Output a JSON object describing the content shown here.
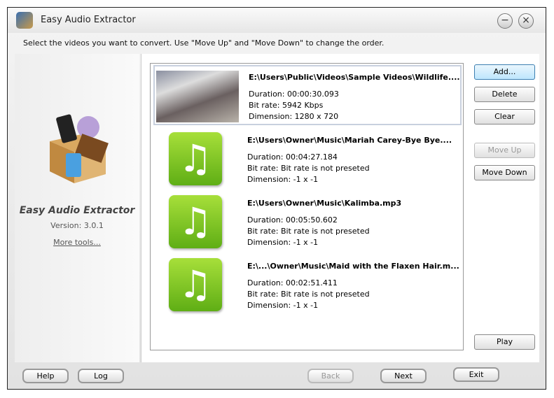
{
  "window": {
    "title": "Easy Audio Extractor",
    "minimize": "−",
    "close": "×"
  },
  "instruction": "Select the videos you want to convert. Use \"Move Up\" and \"Move Down\" to change the order.",
  "sidebar": {
    "app_name": "Easy Audio Extractor",
    "version": "Version: 3.0.1",
    "more_tools": "More tools..."
  },
  "files": [
    {
      "path": "E:\\Users\\Public\\Videos\\Sample Videos\\Wildlife....",
      "duration": "Duration: 00:00:30.093",
      "bitrate": "Bit rate: 5942 Kbps",
      "dimension": "Dimension: 1280 x 720",
      "type": "video"
    },
    {
      "path": "E:\\Users\\Owner\\Music\\Mariah Carey-Bye Bye....",
      "duration": "Duration: 00:04:27.184",
      "bitrate": "Bit rate: Bit rate is not preseted",
      "dimension": "Dimension: -1 x -1",
      "type": "audio"
    },
    {
      "path": "E:\\Users\\Owner\\Music\\Kalimba.mp3",
      "duration": "Duration: 00:05:50.602",
      "bitrate": "Bit rate: Bit rate is not preseted",
      "dimension": "Dimension: -1 x -1",
      "type": "audio"
    },
    {
      "path": "E:\\...\\Owner\\Music\\Maid with the Flaxen Hair.m...",
      "duration": "Duration: 00:02:51.411",
      "bitrate": "Bit rate: Bit rate is not preseted",
      "dimension": "Dimension: -1 x -1",
      "type": "audio"
    }
  ],
  "buttons": {
    "add": "Add...",
    "delete": "Delete",
    "clear": "Clear",
    "move_up": "Move Up",
    "move_down": "Move Down",
    "play": "Play"
  },
  "footer": {
    "help": "Help",
    "log": "Log",
    "back": "Back",
    "next": "Next",
    "exit": "Exit"
  },
  "note_glyph": "♫"
}
